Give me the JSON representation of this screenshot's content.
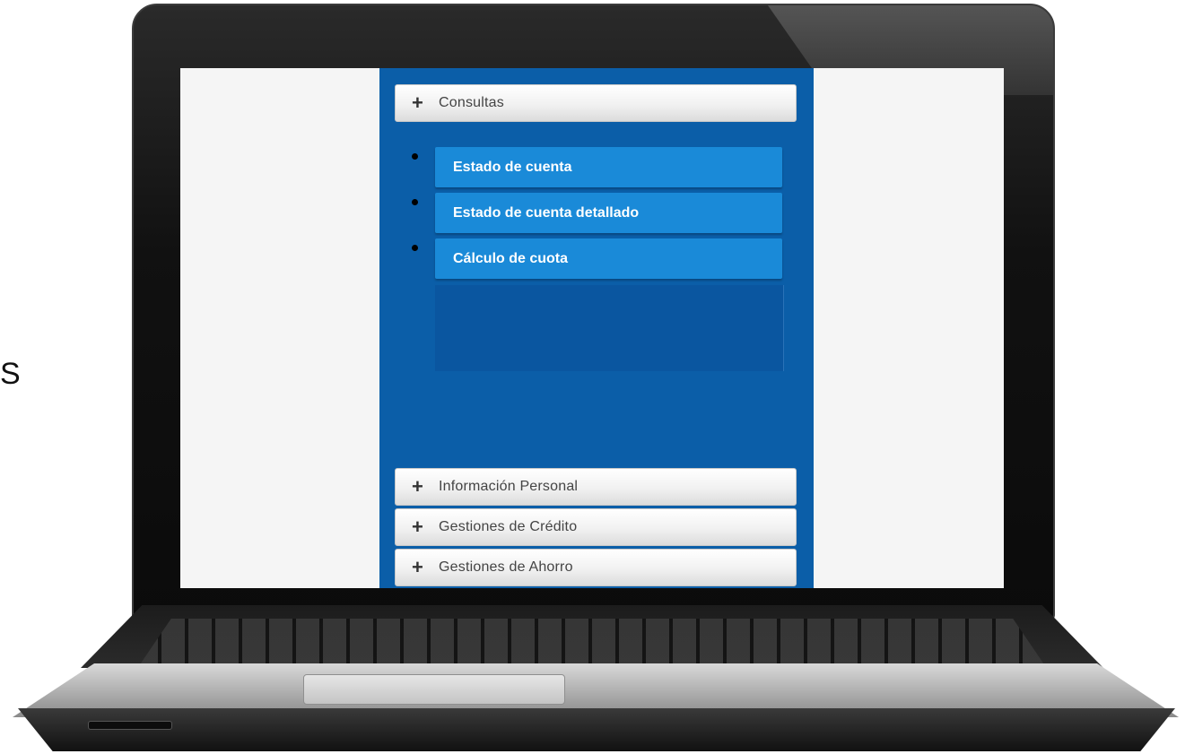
{
  "stray_glyph": "S",
  "menu": {
    "consultas": {
      "label": "Consultas",
      "icon": "plus-icon"
    },
    "consultas_items": [
      "Estado de cuenta",
      "Estado de cuenta detallado",
      "Cálculo de cuota"
    ],
    "informacion_personal": {
      "label": "Información Personal",
      "icon": "plus-icon"
    },
    "gestiones_credito": {
      "label": "Gestiones de Crédito",
      "icon": "plus-icon"
    },
    "gestiones_ahorro": {
      "label": "Gestiones de Ahorro",
      "icon": "plus-icon"
    }
  },
  "colors": {
    "panel_blue": "#0b5ea8",
    "item_blue": "#1a8ad8",
    "screen_bg": "#f5f5f5"
  }
}
